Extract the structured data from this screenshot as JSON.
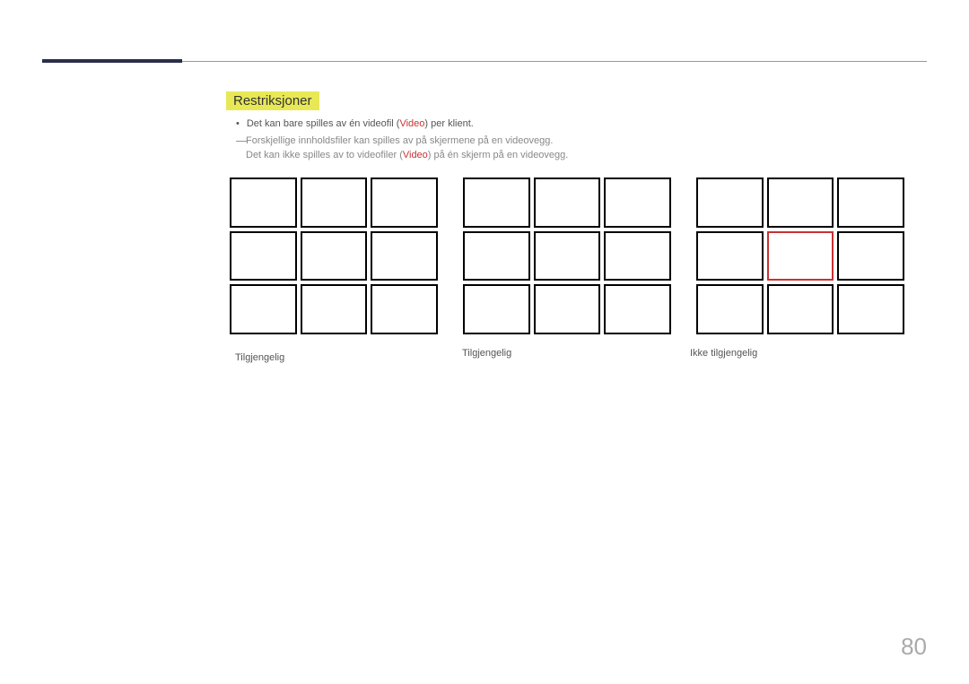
{
  "section_title": "Restriksjoner",
  "bullet_text_before": "Det kan bare spilles av én videofil (",
  "bullet_video_word": "Video",
  "bullet_text_after": ") per klient.",
  "sub_line_1": "Forskjellige innholdsfiler kan spilles av på skjermene på en videovegg.",
  "sub_line_2_before": "Det kan ikke spilles av to videofiler (",
  "sub_line_2_video": "Video",
  "sub_line_2_after": ") på én skjerm på en videovegg.",
  "label_1": "Tilgjengelig",
  "label_2": "Tilgjengelig",
  "label_3": "Ikke tilgjengelig",
  "page_number": "80"
}
